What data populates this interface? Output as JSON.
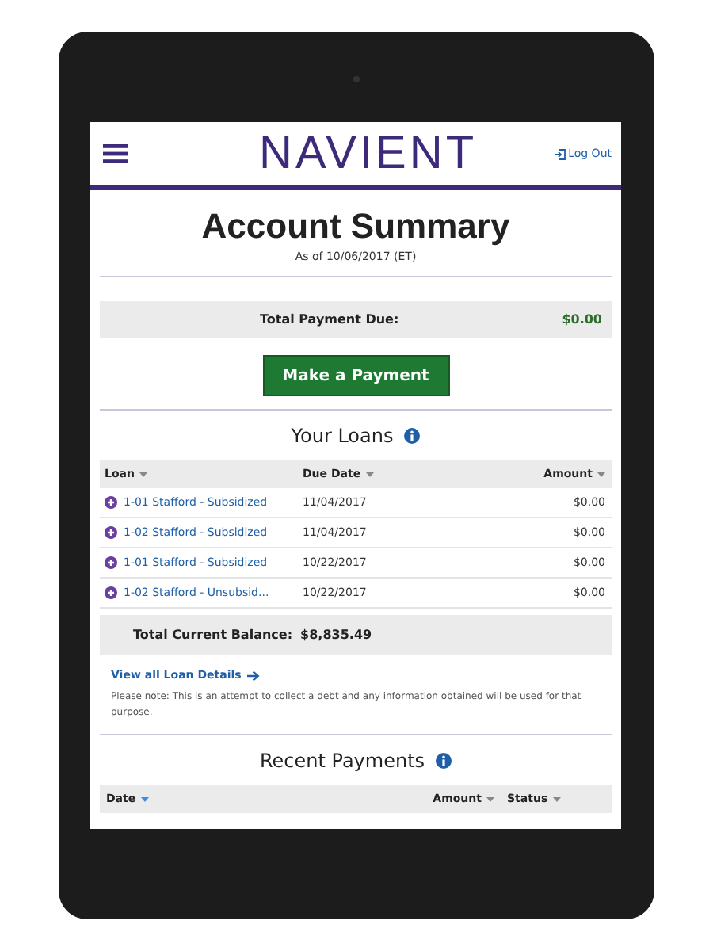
{
  "header": {
    "logo": "NAVIENT",
    "logout": "Log Out"
  },
  "title": "Account Summary",
  "as_of": "As of 10/06/2017 (ET)",
  "payment_due": {
    "label": "Total Payment Due:",
    "amount": "$0.00"
  },
  "pay_button": "Make a Payment",
  "loans": {
    "heading": "Your Loans",
    "columns": [
      {
        "label": "Loan",
        "sorted": false
      },
      {
        "label": "Due Date",
        "sorted": false
      },
      {
        "label": "Amount",
        "sorted": false
      }
    ],
    "rows": [
      {
        "loan": "1-01 Stafford - Subsidized",
        "due": "11/04/2017",
        "amount": "$0.00"
      },
      {
        "loan": "1-02 Stafford - Subsidized",
        "due": "11/04/2017",
        "amount": "$0.00"
      },
      {
        "loan": "1-01 Stafford - Subsidized",
        "due": "10/22/2017",
        "amount": "$0.00"
      },
      {
        "loan": "1-02 Stafford - Unsubsid...",
        "due": "10/22/2017",
        "amount": "$0.00"
      }
    ],
    "balance_label": "Total Current Balance:",
    "balance": "$8,835.49",
    "details_link": "View all Loan Details",
    "note": "Please note: This is an attempt to collect a debt and any information obtained will be used for that purpose."
  },
  "payments": {
    "heading": "Recent Payments",
    "columns": [
      {
        "label": "Date",
        "sorted": true
      },
      {
        "label": "Amount",
        "sorted": false
      },
      {
        "label": "Status",
        "sorted": false
      }
    ]
  }
}
